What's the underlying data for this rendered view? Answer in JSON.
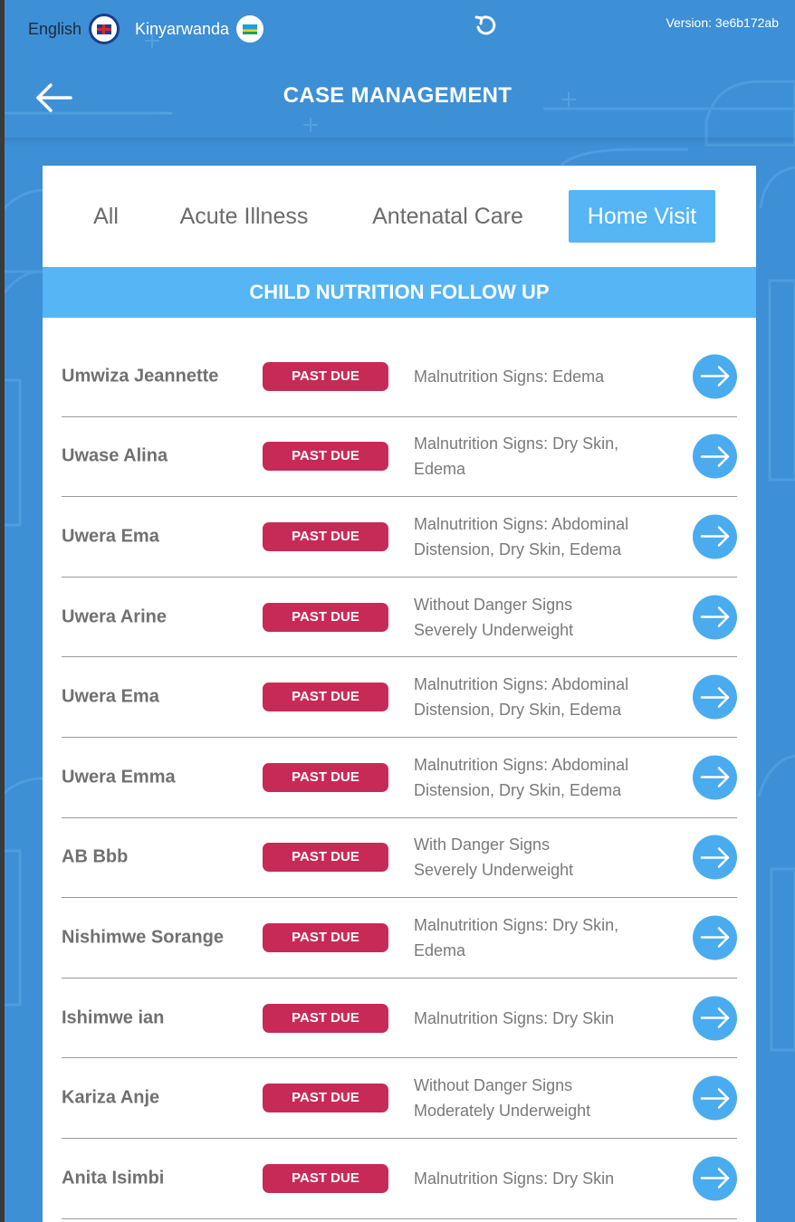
{
  "topbar": {
    "english_label": "English",
    "kinyarwanda_label": "Kinyarwanda",
    "version": "Version: 3e6b172ab"
  },
  "header": {
    "title": "CASE MANAGEMENT"
  },
  "tabs": [
    {
      "label": "All",
      "active": false
    },
    {
      "label": "Acute Illness",
      "active": false
    },
    {
      "label": "Antenatal Care",
      "active": false
    },
    {
      "label": "Home Visit",
      "active": true
    }
  ],
  "section": {
    "title": "CHILD NUTRITION FOLLOW UP"
  },
  "rows": [
    {
      "name": "Umwiza Jeannette",
      "status": "PAST DUE",
      "description": "Malnutrition Signs: Edema"
    },
    {
      "name": "Uwase Alina",
      "status": "PAST DUE",
      "description": "Malnutrition Signs: Dry Skin,\nEdema"
    },
    {
      "name": "Uwera Ema",
      "status": "PAST DUE",
      "description": "Malnutrition Signs: Abdominal\nDistension, Dry Skin, Edema"
    },
    {
      "name": "Uwera Arine",
      "status": "PAST DUE",
      "description": "Without Danger Signs\nSeverely Underweight"
    },
    {
      "name": "Uwera Ema",
      "status": "PAST DUE",
      "description": "Malnutrition Signs: Abdominal\nDistension, Dry Skin, Edema"
    },
    {
      "name": "Uwera Emma",
      "status": "PAST DUE",
      "description": "Malnutrition Signs: Abdominal\nDistension, Dry Skin, Edema"
    },
    {
      "name": "AB Bbb",
      "status": "PAST DUE",
      "description": "With Danger Signs\nSeverely Underweight"
    },
    {
      "name": "Nishimwe Sorange",
      "status": "PAST DUE",
      "description": "Malnutrition Signs: Dry Skin,\nEdema"
    },
    {
      "name": "Ishimwe ian",
      "status": "PAST DUE",
      "description": "Malnutrition Signs: Dry Skin"
    },
    {
      "name": "Kariza Anje",
      "status": "PAST DUE",
      "description": "Without Danger Signs\nModerately Underweight"
    },
    {
      "name": "Anita Isimbi",
      "status": "PAST DUE",
      "description": "Malnutrition Signs: Dry Skin"
    }
  ],
  "colors": {
    "background": "#3d8fd6",
    "accent": "#55b5f5",
    "badge": "#c82a57",
    "arrow_button": "#4aacef"
  },
  "icons": {
    "back": "arrow-left-icon",
    "refresh": "refresh-icon",
    "row_action": "arrow-right-icon"
  }
}
